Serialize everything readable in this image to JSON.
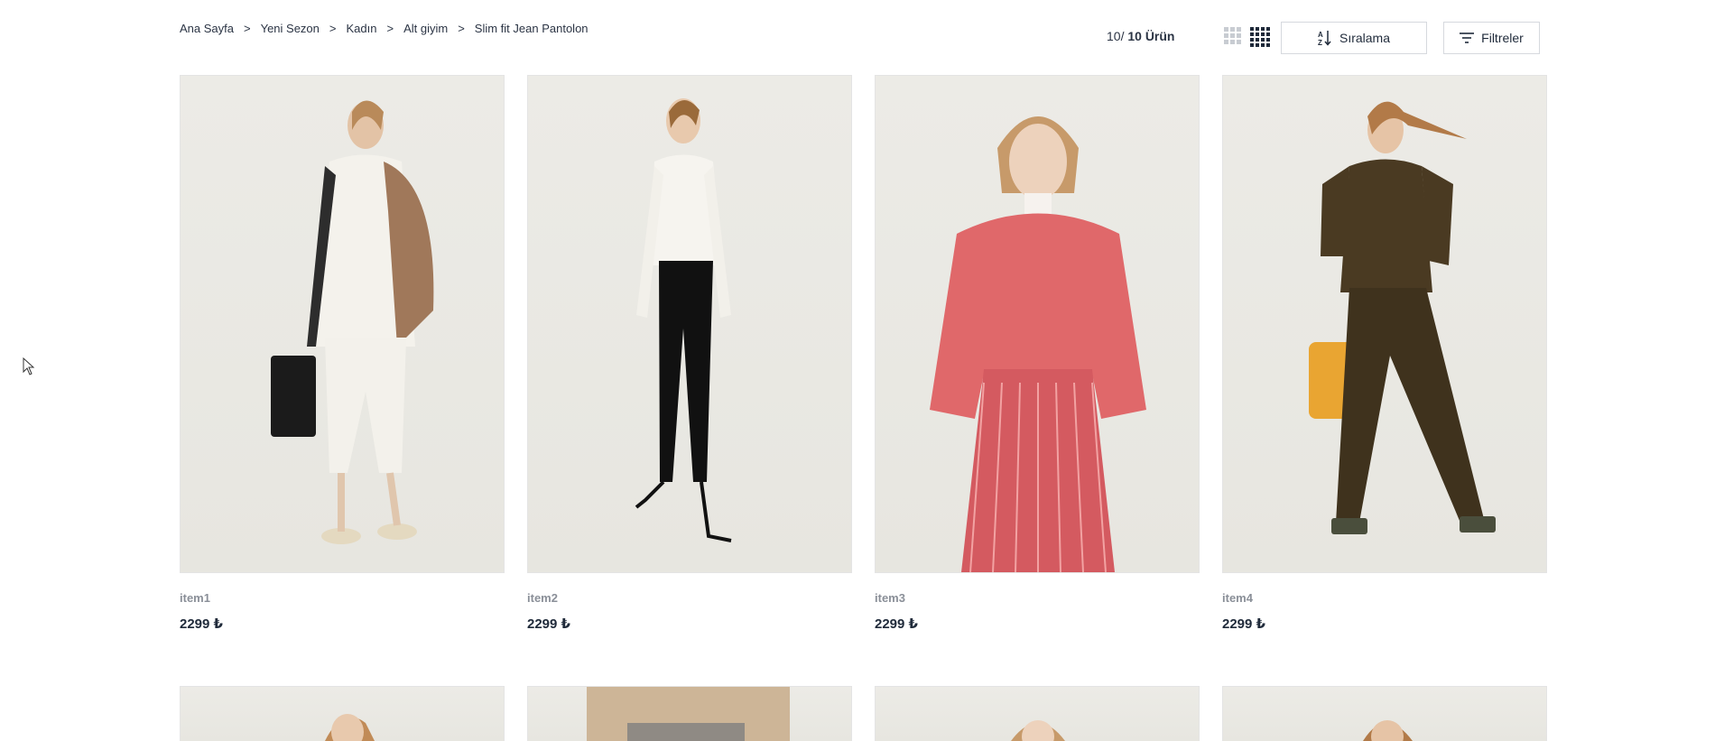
{
  "breadcrumb": [
    "Ana Sayfa",
    "Yeni Sezon",
    "Kadın",
    "Alt giyim",
    "Slim fit Jean Pantolon"
  ],
  "breadcrumb_separator": ">",
  "product_count": {
    "shown": "10/",
    "total": "10 Ürün"
  },
  "toolbar": {
    "sort_label": "Sıralama",
    "filter_label": "Filtreler"
  },
  "products": [
    {
      "name": "item1",
      "price": "2299 ₺",
      "outfit_color": "#f2f0ea",
      "accent": "#a0785a"
    },
    {
      "name": "item2",
      "price": "2299 ₺",
      "outfit_color": "#111111",
      "accent": "#f4f2ee"
    },
    {
      "name": "item3",
      "price": "2299 ₺",
      "outfit_color": "#e0686a",
      "accent": "#f5e9e4"
    },
    {
      "name": "item4",
      "price": "2299 ₺",
      "outfit_color": "#4a3a22",
      "accent": "#e9a532"
    }
  ],
  "colors": {
    "text": "#1f2a3a",
    "muted": "#8a8f98",
    "border": "#d6d9de",
    "image_bg": "#ecebe6"
  }
}
